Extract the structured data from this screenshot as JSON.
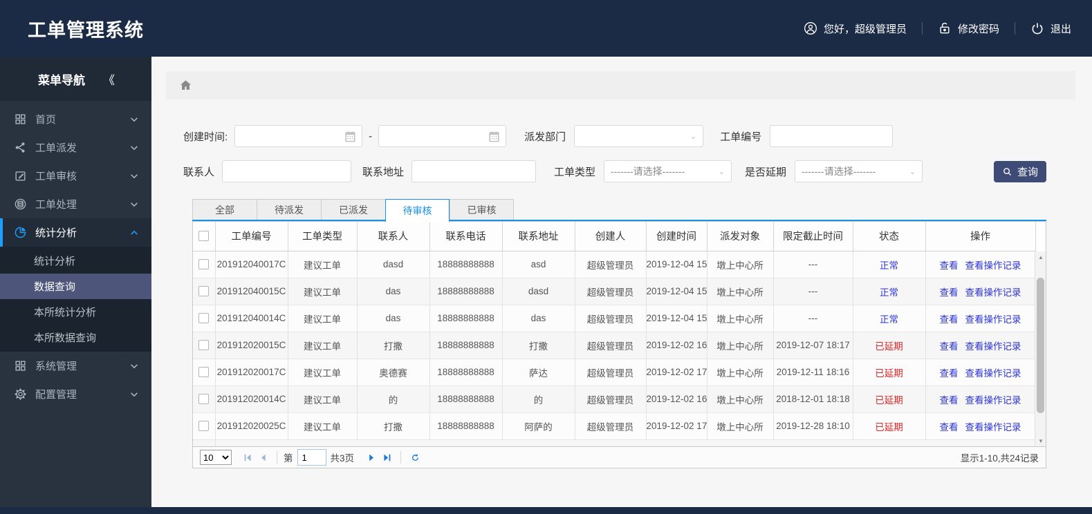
{
  "colors": {
    "header_bg": "#1c2b45",
    "sidebar_bg": "#29333f",
    "accent_blue": "#1e9fff",
    "tab_blue": "#1790e8",
    "link_blue": "#2d35d2",
    "status_red": "#e02626",
    "button_bg": "#3e4b76"
  },
  "header": {
    "title": "工单管理系统",
    "greeting": "您好，超级管理员",
    "change_password": "修改密码",
    "logout": "退出"
  },
  "sidebar": {
    "nav_title": "菜单导航",
    "collapse_icon": "《",
    "items": [
      {
        "label": "首页",
        "icon": "grid-icon",
        "expanded": false,
        "active": false
      },
      {
        "label": "工单派发",
        "icon": "share-icon",
        "expanded": false,
        "active": false
      },
      {
        "label": "工单审核",
        "icon": "edit-icon",
        "expanded": false,
        "active": false
      },
      {
        "label": "工单处理",
        "icon": "database-icon",
        "expanded": false,
        "active": false
      },
      {
        "label": "统计分析",
        "icon": "pie-chart-icon",
        "expanded": true,
        "active": true,
        "children": [
          {
            "label": "统计分析",
            "active": false
          },
          {
            "label": "数据查询",
            "active": true
          },
          {
            "label": "本所统计分析",
            "active": false
          },
          {
            "label": "本所数据查询",
            "active": false
          }
        ]
      },
      {
        "label": "系统管理",
        "icon": "grid-icon",
        "expanded": false,
        "active": false
      },
      {
        "label": "配置管理",
        "icon": "gear-icon",
        "expanded": false,
        "active": false
      }
    ]
  },
  "filters": {
    "create_time_label": "创建时间:",
    "range_separator": "-",
    "dispatch_dept_label": "派发部门",
    "order_no_label": "工单编号",
    "contact_label": "联系人",
    "address_label": "联系地址",
    "order_type_label": "工单类型",
    "delayed_label": "是否延期",
    "select_placeholder": "-------请选择-------",
    "empty_select_value": "",
    "search_button": "查询"
  },
  "tabs": [
    {
      "label": "全部",
      "active": false
    },
    {
      "label": "待派发",
      "active": false
    },
    {
      "label": "已派发",
      "active": false
    },
    {
      "label": "待审核",
      "active": true
    },
    {
      "label": "已审核",
      "active": false
    }
  ],
  "table": {
    "columns": [
      "工单编号",
      "工单类型",
      "联系人",
      "联系电话",
      "联系地址",
      "创建人",
      "创建时间",
      "派发对象",
      "限定截止时间",
      "状态",
      "操作"
    ],
    "view_label": "查看",
    "view_log_label": "查看操作记录",
    "rows": [
      {
        "order_no": "201912040017C",
        "type": "建议工单",
        "contact": "dasd",
        "phone": "18888888888",
        "address": "asd",
        "creator": "超级管理员",
        "created": "2019-12-04 15",
        "target": "墩上中心所",
        "deadline": "---",
        "status": "正常",
        "delayed": false
      },
      {
        "order_no": "201912040015C",
        "type": "建议工单",
        "contact": "das",
        "phone": "18888888888",
        "address": "dasd",
        "creator": "超级管理员",
        "created": "2019-12-04 15",
        "target": "墩上中心所",
        "deadline": "---",
        "status": "正常",
        "delayed": false
      },
      {
        "order_no": "201912040014C",
        "type": "建议工单",
        "contact": "das",
        "phone": "18888888888",
        "address": "das",
        "creator": "超级管理员",
        "created": "2019-12-04 15",
        "target": "墩上中心所",
        "deadline": "---",
        "status": "正常",
        "delayed": false
      },
      {
        "order_no": "201912020015C",
        "type": "建议工单",
        "contact": "打撒",
        "phone": "18888888888",
        "address": "打撒",
        "creator": "超级管理员",
        "created": "2019-12-02 16",
        "target": "墩上中心所",
        "deadline": "2019-12-07 18:17",
        "status": "已延期",
        "delayed": true
      },
      {
        "order_no": "201912020017C",
        "type": "建议工单",
        "contact": "奥德赛",
        "phone": "18888888888",
        "address": "萨达",
        "creator": "超级管理员",
        "created": "2019-12-02 17",
        "target": "墩上中心所",
        "deadline": "2019-12-11 18:16",
        "status": "已延期",
        "delayed": true
      },
      {
        "order_no": "201912020014C",
        "type": "建议工单",
        "contact": "的",
        "phone": "18888888888",
        "address": "的",
        "creator": "超级管理员",
        "created": "2019-12-02 16",
        "target": "墩上中心所",
        "deadline": "2018-12-01 18:18",
        "status": "已延期",
        "delayed": true
      },
      {
        "order_no": "201912020025C",
        "type": "建议工单",
        "contact": "打撒",
        "phone": "18888888888",
        "address": "阿萨的",
        "creator": "超级管理员",
        "created": "2019-12-02 17",
        "target": "墩上中心所",
        "deadline": "2019-12-28 18:10",
        "status": "已延期",
        "delayed": true
      }
    ]
  },
  "pagination": {
    "page_size": "10",
    "page_prefix": "第",
    "current_page": "1",
    "total_pages": "共3页",
    "summary": "显示1-10,共24记录"
  }
}
